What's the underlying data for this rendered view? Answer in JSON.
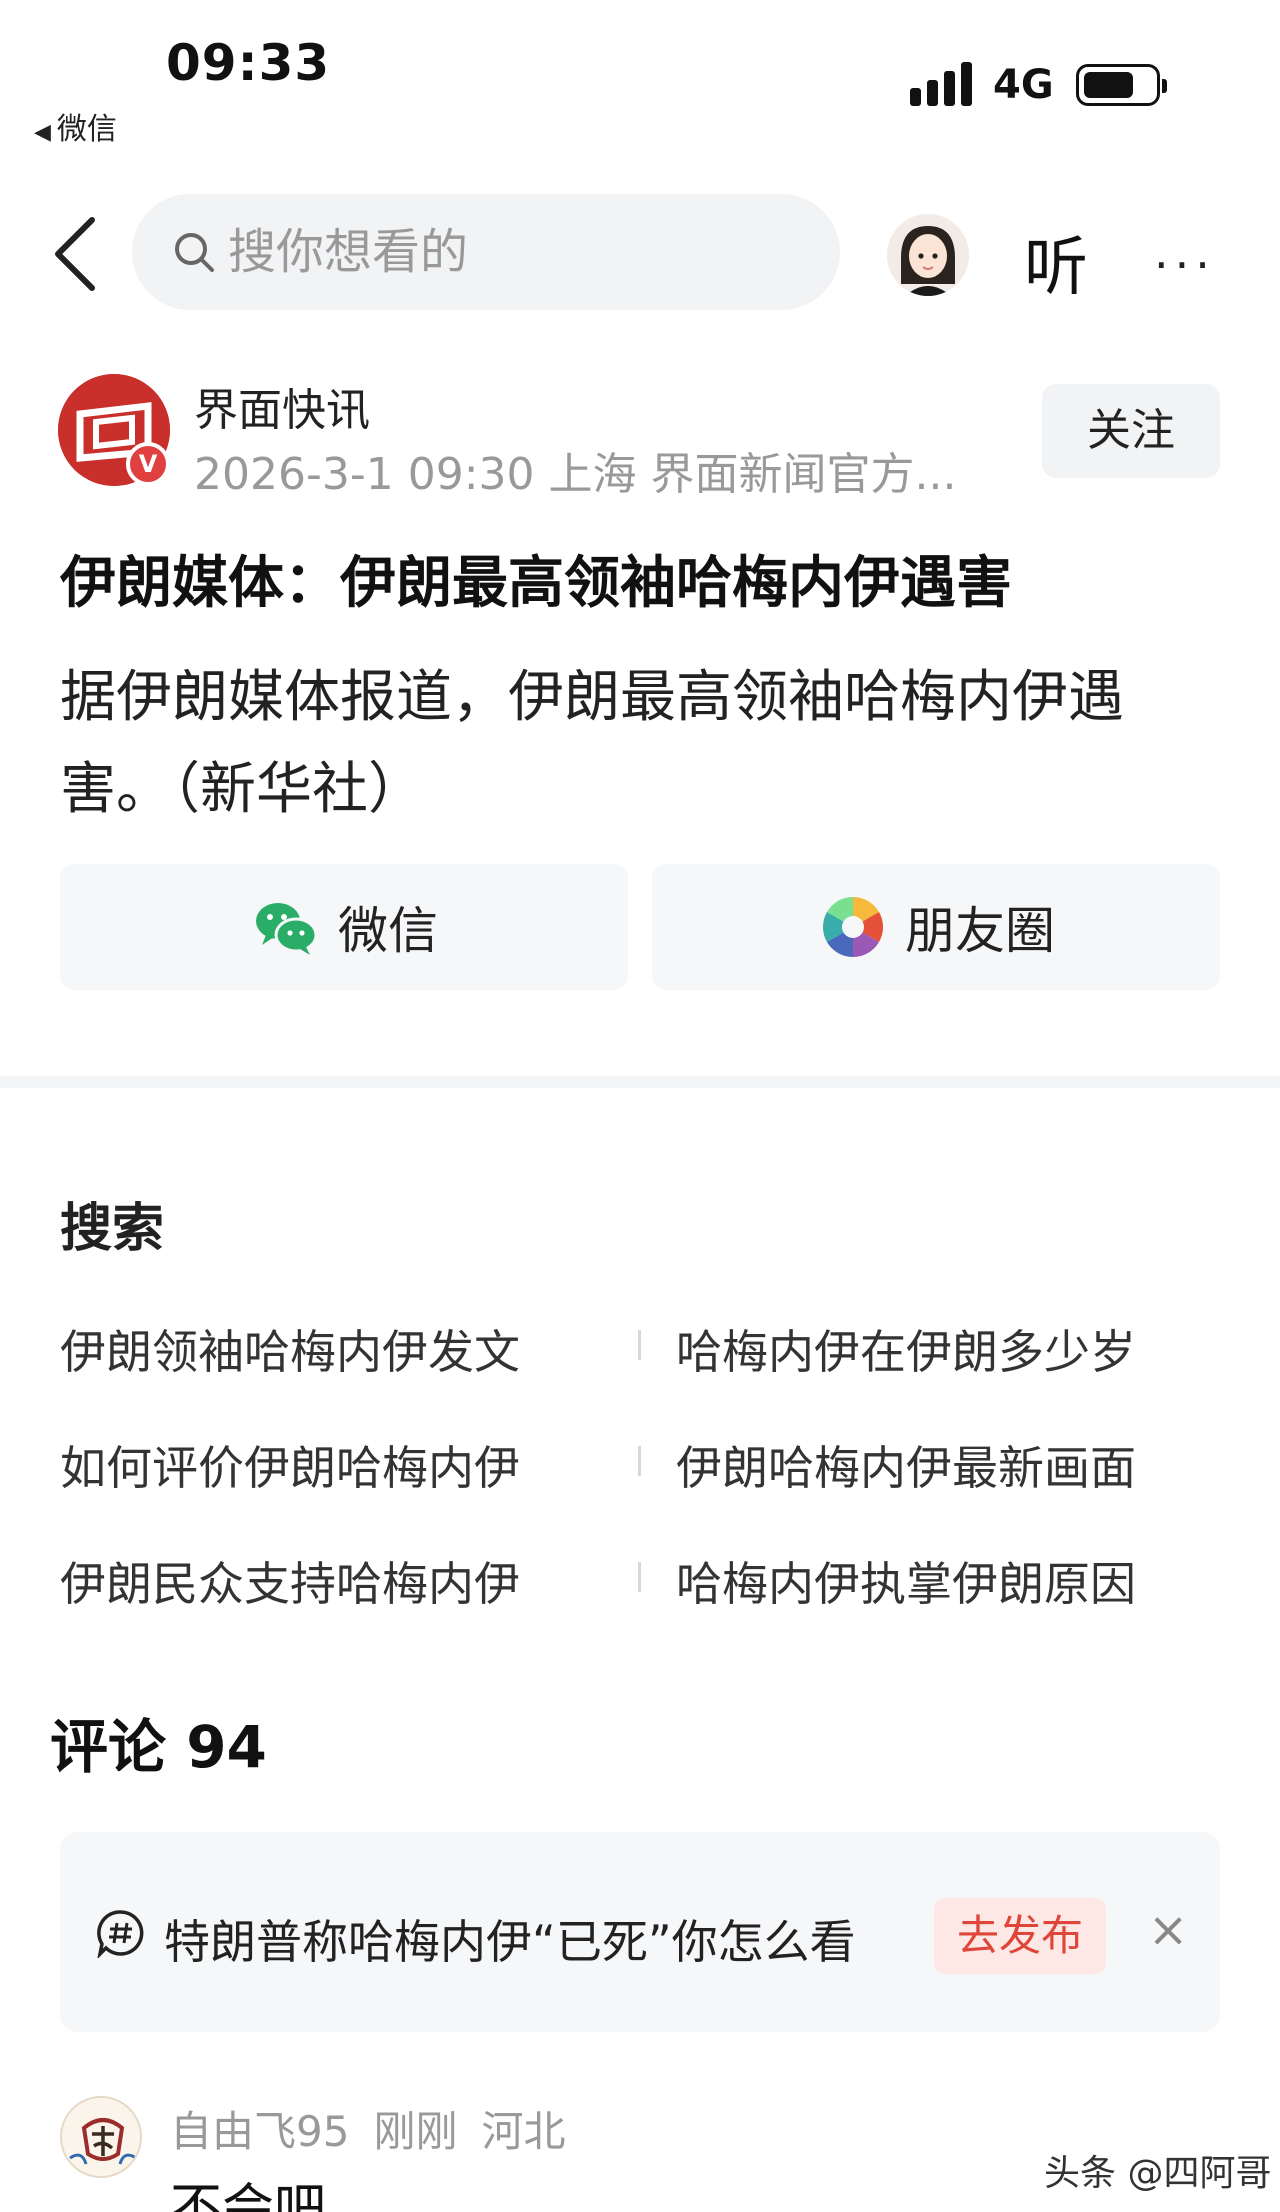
{
  "status_bar": {
    "time": "09:33",
    "back_app": "微信",
    "network": "4G",
    "battery_level": 0.72
  },
  "header": {
    "search_placeholder": "搜你想看的",
    "listen_label": "听",
    "more_label": "···"
  },
  "author": {
    "name": "界面快讯",
    "badge": "V",
    "meta": "2026-3-1 09:30 上海 界面新闻官方...",
    "follow_label": "关注"
  },
  "article": {
    "title": "伊朗媒体：伊朗最高领袖哈梅内伊遇害",
    "body": "据伊朗媒体报道，伊朗最高领袖哈梅内伊遇害。（新华社）"
  },
  "share": {
    "wechat_label": "微信",
    "moments_label": "朋友圈"
  },
  "search_section": {
    "title": "搜索",
    "suggestions": [
      "伊朗领袖哈梅内伊发文",
      "哈梅内伊在伊朗多少岁",
      "如何评价伊朗哈梅内伊",
      "伊朗哈梅内伊最新画面",
      "伊朗民众支持哈梅内伊",
      "哈梅内伊执掌伊朗原因"
    ]
  },
  "comments": {
    "title": "评论 94",
    "topic_text": "特朗普称哈梅内伊“已死”你怎么看",
    "topic_button": "去发布",
    "topic_close": "×",
    "first_comment": {
      "user": "自由飞95",
      "time": "刚刚",
      "location": "河北",
      "text": "不会吧"
    }
  },
  "watermark": "头条 @四阿哥",
  "colors": {
    "accent_red": "#e0453a",
    "brand_red": "#c9302c",
    "muted_text": "#999999",
    "card_bg": "#f6f7f9"
  }
}
